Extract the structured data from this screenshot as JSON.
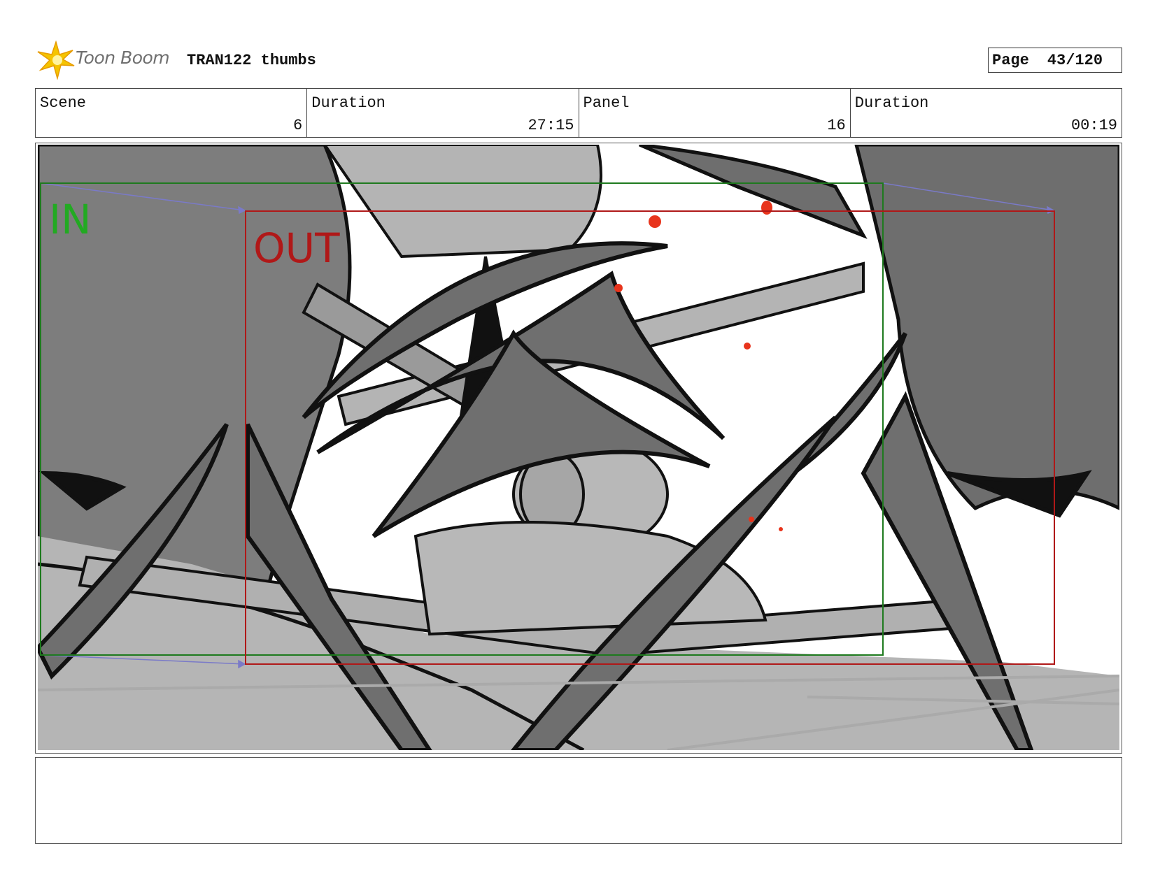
{
  "header": {
    "logo_text": "Toon Boom",
    "project_title": "TRAN122 thumbs",
    "page_label": "Page",
    "page_value": "43/120"
  },
  "info": [
    {
      "caption": "Scene",
      "value": "6"
    },
    {
      "caption": "Duration",
      "value": "27:15"
    },
    {
      "caption": "Panel",
      "value": "16"
    },
    {
      "caption": "Duration",
      "value": "00:19"
    }
  ],
  "panel": {
    "in_label": "IN",
    "out_label": "OUT",
    "in_color": "#1e7a1e",
    "out_color": "#b01818",
    "camera_path_color": "#7a7ac8",
    "accent_red": "#e8341c"
  },
  "notes": {
    "text": ""
  }
}
